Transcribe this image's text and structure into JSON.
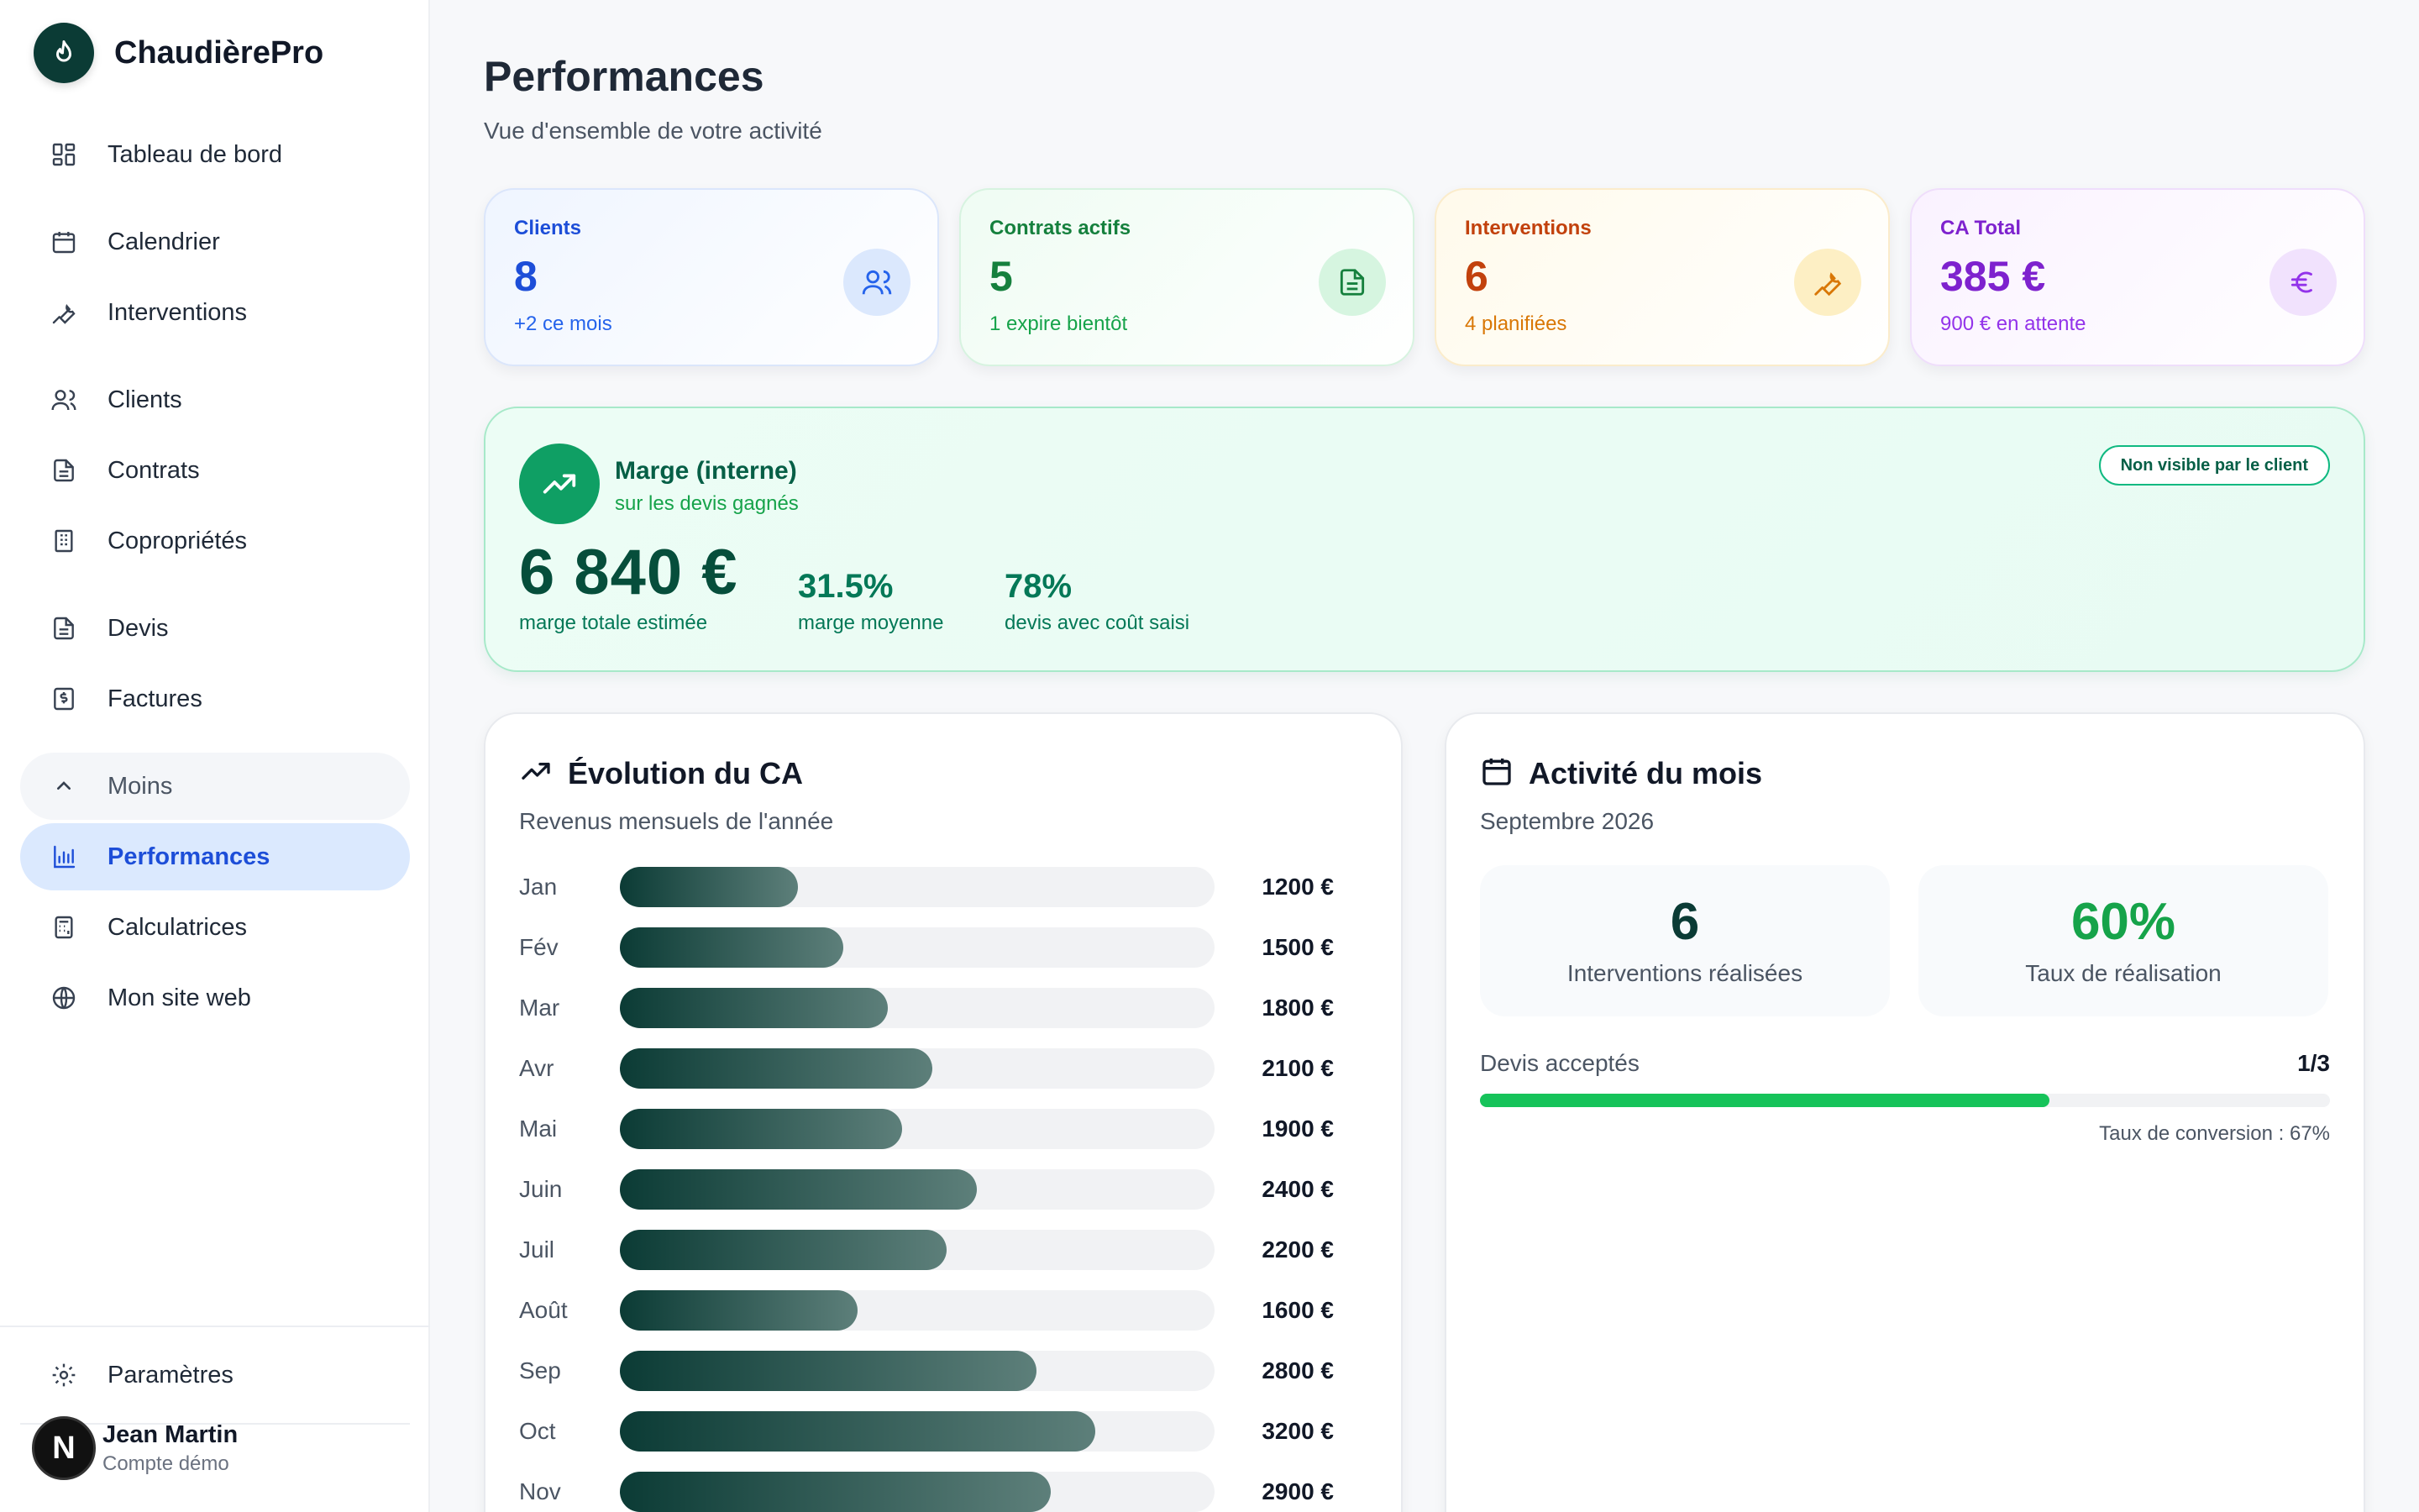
{
  "app": {
    "name": "ChaudièrePro"
  },
  "sidebar": {
    "items": [
      {
        "label": "Tableau de bord",
        "icon": "dashboard-icon"
      },
      {
        "label": "Calendrier",
        "icon": "calendar-icon"
      },
      {
        "label": "Interventions",
        "icon": "wrench-icon"
      },
      {
        "label": "Clients",
        "icon": "users-icon"
      },
      {
        "label": "Contrats",
        "icon": "document-icon"
      },
      {
        "label": "Copropriétés",
        "icon": "building-icon"
      },
      {
        "label": "Devis",
        "icon": "document-icon"
      },
      {
        "label": "Factures",
        "icon": "invoice-icon"
      },
      {
        "label": "Moins",
        "icon": "chevron-up-icon"
      },
      {
        "label": "Performances",
        "icon": "bar-chart-icon",
        "active": true
      },
      {
        "label": "Calculatrices",
        "icon": "calculator-icon"
      },
      {
        "label": "Mon site web",
        "icon": "globe-icon"
      },
      {
        "label": "Paramètres",
        "icon": "gear-icon"
      }
    ],
    "user": {
      "initial": "N",
      "name": "Jean Martin",
      "role": "Compte démo"
    }
  },
  "page": {
    "title": "Performances",
    "subtitle": "Vue d'ensemble de votre activité"
  },
  "stats": [
    {
      "label": "Clients",
      "value": "8",
      "sub": "+2 ce mois",
      "icon": "users-icon",
      "color": "#1d4ed8"
    },
    {
      "label": "Contrats actifs",
      "value": "5",
      "sub": "1 expire bientôt",
      "icon": "document-icon",
      "color": "#15803d"
    },
    {
      "label": "Interventions",
      "value": "6",
      "sub": "4 planifiées",
      "icon": "wrench-icon",
      "color": "#c2410c"
    },
    {
      "label": "CA Total",
      "value": "385 €",
      "sub": "900 € en attente",
      "icon": "euro-icon",
      "color": "#7e22ce"
    }
  ],
  "margin": {
    "title": "Marge (interne)",
    "subtitle": "sur les devis gagnés",
    "badge": "Non visible par le client",
    "total": "6 840 €",
    "total_label": "marge totale estimée",
    "avg": "31.5%",
    "avg_label": "marge moyenne",
    "cost": "78%",
    "cost_label": "devis avec coût saisi"
  },
  "revenue": {
    "title": "Évolution du CA",
    "subtitle": "Revenus mensuels de l'année",
    "rows": [
      {
        "month": "Jan",
        "value": 1200,
        "label": "1200 €"
      },
      {
        "month": "Fév",
        "value": 1500,
        "label": "1500 €"
      },
      {
        "month": "Mar",
        "value": 1800,
        "label": "1800 €"
      },
      {
        "month": "Avr",
        "value": 2100,
        "label": "2100 €"
      },
      {
        "month": "Mai",
        "value": 1900,
        "label": "1900 €"
      },
      {
        "month": "Juin",
        "value": 2400,
        "label": "2400 €"
      },
      {
        "month": "Juil",
        "value": 2200,
        "label": "2200 €"
      },
      {
        "month": "Août",
        "value": 1600,
        "label": "1600 €"
      },
      {
        "month": "Sep",
        "value": 2800,
        "label": "2800 €"
      },
      {
        "month": "Oct",
        "value": 3200,
        "label": "3200 €"
      },
      {
        "month": "Nov",
        "value": 2900,
        "label": "2900 €"
      }
    ],
    "max": 4000
  },
  "activity": {
    "title": "Activité du mois",
    "subtitle": "Septembre 2026",
    "interventions_value": "6",
    "interventions_label": "Interventions réalisées",
    "rate_value": "60%",
    "rate_label": "Taux de réalisation",
    "devis_label": "Devis acceptés",
    "devis_value": "1/3",
    "devis_progress": 0.67,
    "conversion": "Taux de conversion : 67%"
  },
  "colors": {
    "brand": "#0b3b35",
    "active": "#1d4ed8",
    "margin_green": "#0f9f64",
    "progress_green": "#16c35a",
    "rate_green": "#16a34a"
  }
}
